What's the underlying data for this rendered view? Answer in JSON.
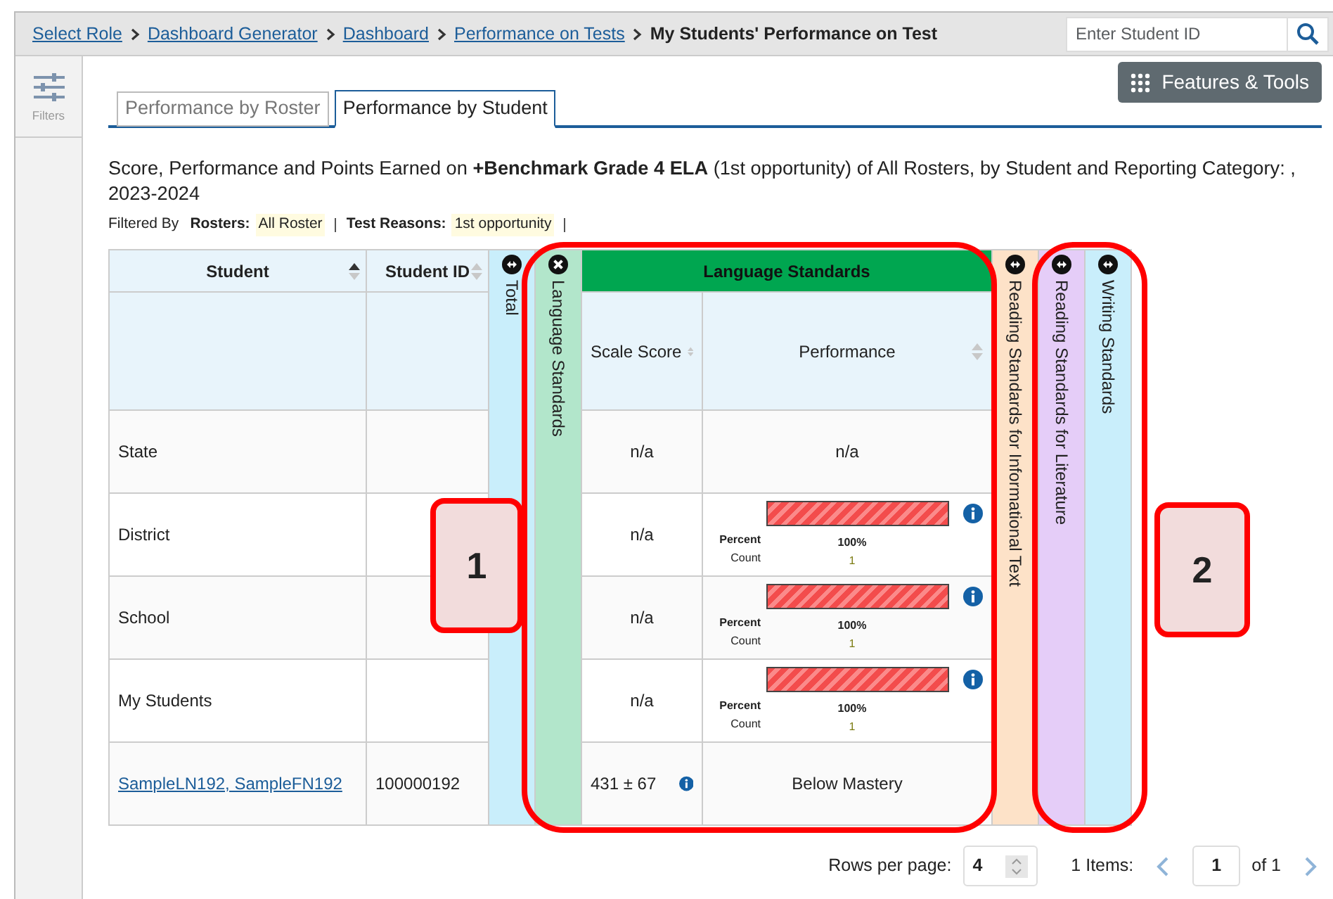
{
  "breadcrumbs": [
    {
      "label": "Select Role",
      "link": true
    },
    {
      "label": "Dashboard Generator",
      "link": true
    },
    {
      "label": "Dashboard",
      "link": true
    },
    {
      "label": "Performance on Tests",
      "link": true
    },
    {
      "label": "My Students' Performance on Test",
      "link": false
    }
  ],
  "student_search": {
    "placeholder": "Enter Student ID"
  },
  "sidebar": {
    "filters_label": "Filters"
  },
  "tabs": [
    {
      "label": "Performance by Roster",
      "selected": false
    },
    {
      "label": "Performance by Student",
      "selected": true
    }
  ],
  "features_button": "Features & Tools",
  "report_title": "Score, Performance and Points Earned on **+Benchmark Grade 4 ELA** (1st opportunity) of All Rosters, by Student and Reporting Category: , 2023-2024",
  "filtered_by": "Filtered By",
  "filters": [
    {
      "label": "Rosters:",
      "value": "All Roster"
    },
    {
      "label": "Test Reasons:",
      "value": "1st opportunity"
    }
  ],
  "table": {
    "columns": [
      {
        "kind": "sortable",
        "label": "Student",
        "sorted": true
      },
      {
        "kind": "sortable",
        "label": "Student ID",
        "sorted": false
      },
      {
        "kind": "collapsed",
        "label": "Total",
        "color": "#c9eefb",
        "expanded": false
      },
      {
        "kind": "collapsed",
        "label": "Language Standards",
        "color": "#b2e6cb",
        "expanded": true
      },
      {
        "kind": "group",
        "label": "Language Standards",
        "subcolumns": [
          {
            "label": "Scale Score",
            "sorted": false
          },
          {
            "label": "Performance",
            "sorted": false
          }
        ]
      },
      {
        "kind": "collapsed",
        "label": "Reading Standards for Informational Text",
        "color": "#fde2c8",
        "expanded": false
      },
      {
        "kind": "collapsed",
        "label": "Reading Standards for Literature",
        "color": "#e5cdf8",
        "expanded": false
      },
      {
        "kind": "collapsed",
        "label": "Writing Standards",
        "color": "#c9eefb",
        "expanded": false
      }
    ],
    "rows": [
      {
        "student": "State",
        "link": false,
        "scale_score": "n/a",
        "score_info": false,
        "performance": {
          "kind": "text",
          "text": "n/a"
        }
      },
      {
        "student": "District",
        "link": false,
        "scale_score": "n/a",
        "score_info": false,
        "performance": {
          "kind": "bar",
          "level": 1,
          "percent_label": "Percent",
          "percent": "100%",
          "count_label": "Count",
          "count": "1"
        }
      },
      {
        "student": "School",
        "link": false,
        "scale_score": "n/a",
        "score_info": false,
        "performance": {
          "kind": "bar",
          "level": 1,
          "percent_label": "Percent",
          "percent": "100%",
          "count_label": "Count",
          "count": "1"
        }
      },
      {
        "student": "My Students",
        "link": false,
        "scale_score": "n/a",
        "score_info": false,
        "performance": {
          "kind": "bar",
          "level": 1,
          "percent_label": "Percent",
          "percent": "100%",
          "count_label": "Count",
          "count": "1"
        }
      },
      {
        "student": "SampleLN192, SampleFN192",
        "link": true,
        "student_id": "100000192",
        "scale_score": "431 ± 67",
        "score_info": true,
        "performance": {
          "kind": "text",
          "text": "Below Mastery"
        }
      }
    ]
  },
  "pagination": {
    "rows_label": "Rows per page:",
    "rows_value": "4",
    "items": "1 Items:",
    "page": "1",
    "of": "of 1"
  },
  "callouts": [
    {
      "label": "1"
    },
    {
      "label": "2"
    }
  ]
}
